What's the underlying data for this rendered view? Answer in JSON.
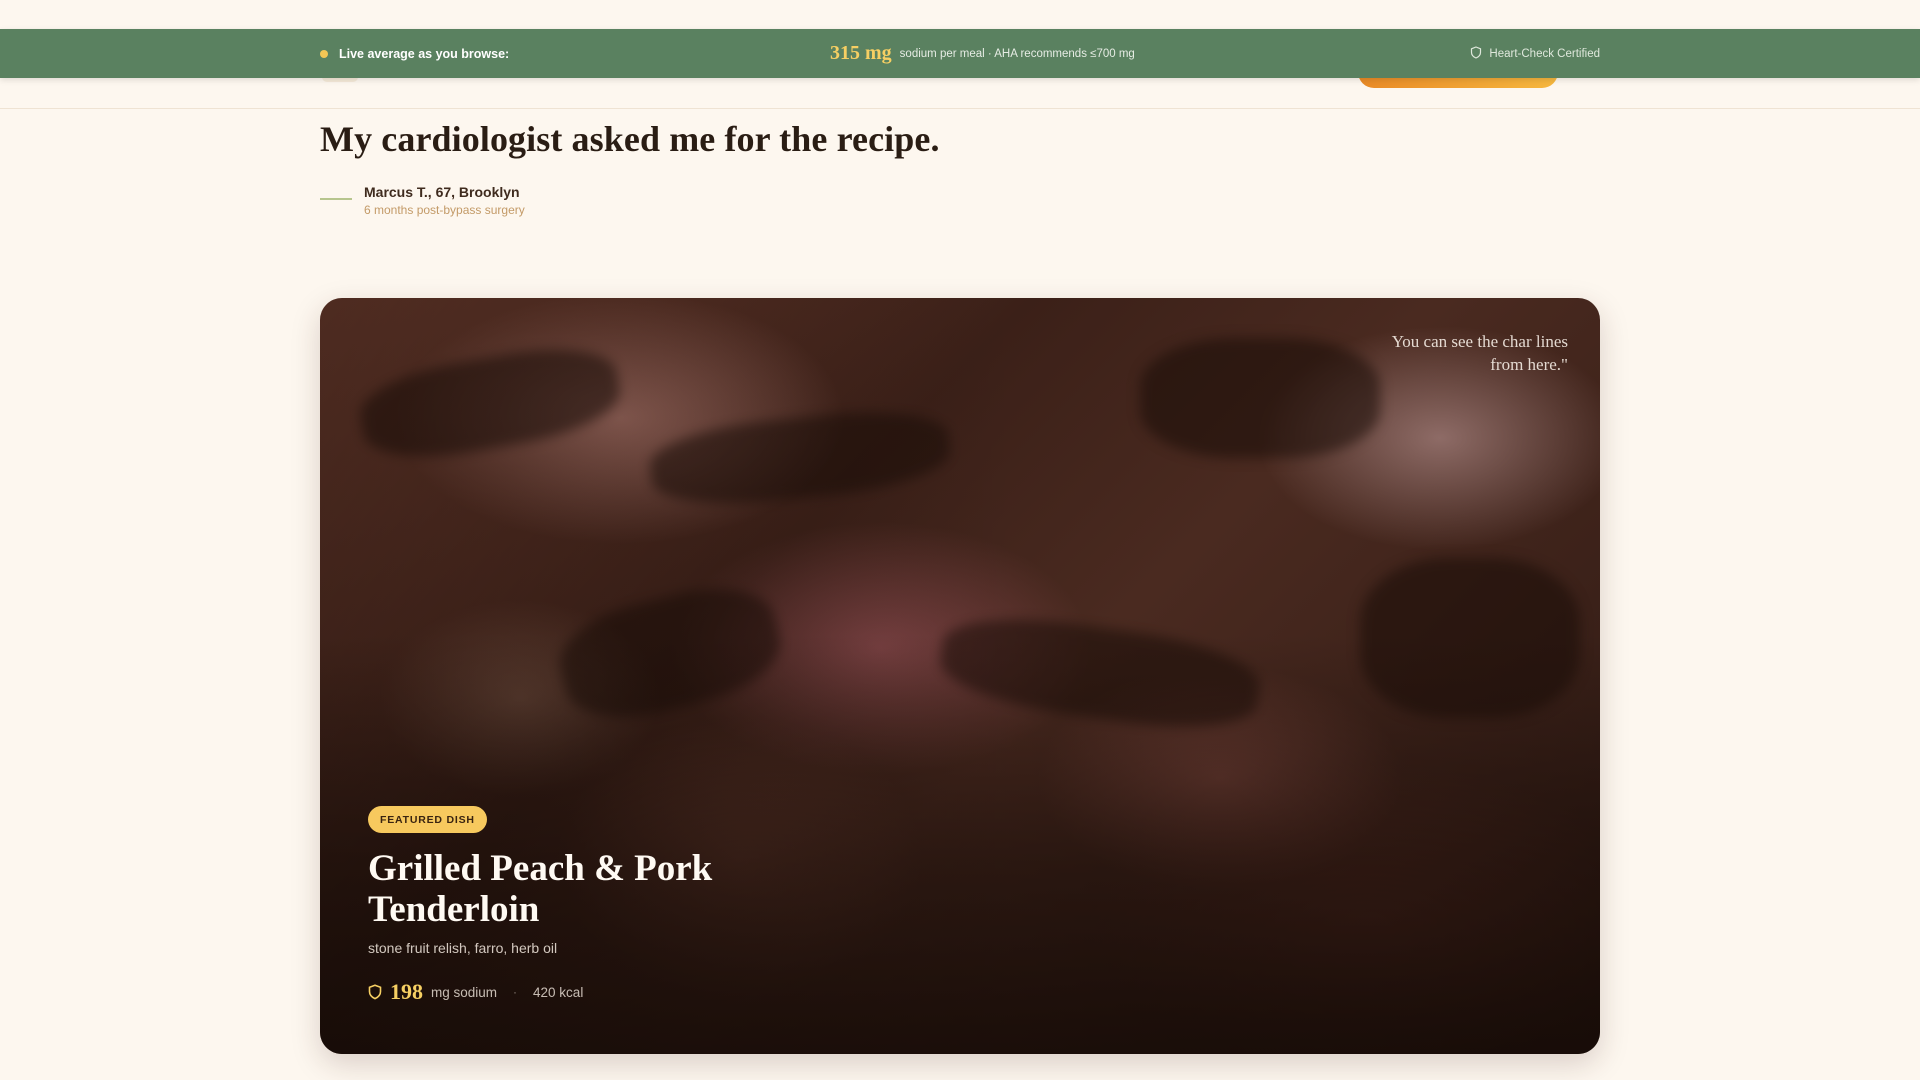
{
  "sodium_bar": {
    "label": "Live average as you browse:",
    "value": "315 mg",
    "note": "sodium per meal · AHA recommends ≤700 mg",
    "certified": "Heart-Check Certified",
    "colors": {
      "bar": "#5a8160",
      "accent": "#f6cf63"
    }
  },
  "testimonial": {
    "quote": "My cardiologist asked me for the recipe.",
    "author": "Marcus T., 67, Brooklyn",
    "detail": "6 months post-bypass surgery"
  },
  "featured": {
    "image_quote": "You can see the char lines from here.\"",
    "badge": "FEATURED DISH",
    "title": "Grilled Peach & Pork Tenderloin",
    "subtitle": "stone fruit relish, farro, herb oil",
    "sodium_value": "198",
    "sodium_unit": "mg sodium",
    "separator": "·",
    "calories": "420 kcal",
    "colors": {
      "badge": "#f7c95e",
      "value": "#f6cf63"
    }
  }
}
